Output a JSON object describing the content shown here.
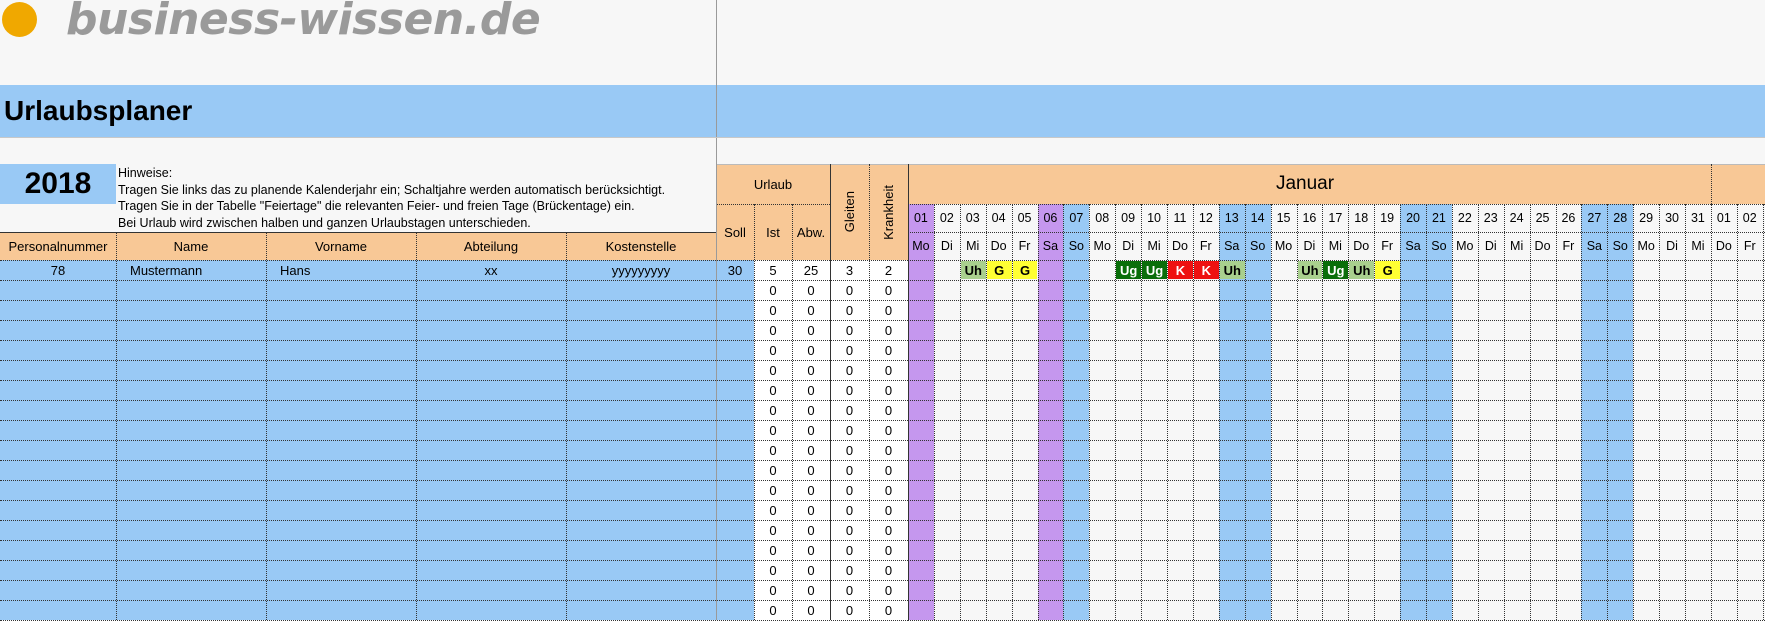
{
  "brand": {
    "name": "business-wissen.de"
  },
  "title": "Urlaubsplaner",
  "year": "2018",
  "notes": {
    "heading": "Hinweise:",
    "lines": [
      "Tragen Sie links das zu planende Kalenderjahr ein; Schaltjahre werden automatisch berücksichtigt.",
      "Tragen Sie in der Tabelle \"Feiertage\" die relevanten Feier- und freien Tage (Brückentage) ein.",
      "Bei Urlaub wird zwischen halben und ganzen Urlaubstagen unterschieden."
    ]
  },
  "columns": [
    "Personalnummer",
    "Name",
    "Vorname",
    "Abteilung",
    "Kostenstelle"
  ],
  "urlaub_header": "Urlaub",
  "urlaub_cols": [
    "Soll",
    "Ist",
    "Abw."
  ],
  "gleiten_header": "Gleiten",
  "krankheit_header": "Krankheit",
  "month": "Januar",
  "days": [
    {
      "n": "01",
      "d": "Mo",
      "t": "h"
    },
    {
      "n": "02",
      "d": "Di",
      "t": "w"
    },
    {
      "n": "03",
      "d": "Mi",
      "t": "w"
    },
    {
      "n": "04",
      "d": "Do",
      "t": "w"
    },
    {
      "n": "05",
      "d": "Fr",
      "t": "w"
    },
    {
      "n": "06",
      "d": "Sa",
      "t": "h"
    },
    {
      "n": "07",
      "d": "So",
      "t": "e"
    },
    {
      "n": "08",
      "d": "Mo",
      "t": "w"
    },
    {
      "n": "09",
      "d": "Di",
      "t": "w"
    },
    {
      "n": "10",
      "d": "Mi",
      "t": "w"
    },
    {
      "n": "11",
      "d": "Do",
      "t": "w"
    },
    {
      "n": "12",
      "d": "Fr",
      "t": "w"
    },
    {
      "n": "13",
      "d": "Sa",
      "t": "e"
    },
    {
      "n": "14",
      "d": "So",
      "t": "e"
    },
    {
      "n": "15",
      "d": "Mo",
      "t": "w"
    },
    {
      "n": "16",
      "d": "Di",
      "t": "w"
    },
    {
      "n": "17",
      "d": "Mi",
      "t": "w"
    },
    {
      "n": "18",
      "d": "Do",
      "t": "w"
    },
    {
      "n": "19",
      "d": "Fr",
      "t": "w"
    },
    {
      "n": "20",
      "d": "Sa",
      "t": "e"
    },
    {
      "n": "21",
      "d": "So",
      "t": "e"
    },
    {
      "n": "22",
      "d": "Mo",
      "t": "w"
    },
    {
      "n": "23",
      "d": "Di",
      "t": "w"
    },
    {
      "n": "24",
      "d": "Mi",
      "t": "w"
    },
    {
      "n": "25",
      "d": "Do",
      "t": "w"
    },
    {
      "n": "26",
      "d": "Fr",
      "t": "w"
    },
    {
      "n": "27",
      "d": "Sa",
      "t": "e"
    },
    {
      "n": "28",
      "d": "So",
      "t": "e"
    },
    {
      "n": "29",
      "d": "Mo",
      "t": "w"
    },
    {
      "n": "30",
      "d": "Di",
      "t": "w"
    },
    {
      "n": "31",
      "d": "Mi",
      "t": "w"
    },
    {
      "n": "01",
      "d": "Do",
      "t": "w"
    },
    {
      "n": "02",
      "d": "Fr",
      "t": "w"
    }
  ],
  "employee": {
    "personalnummer": "78",
    "name": "Mustermann",
    "vorname": "Hans",
    "abteilung": "xx",
    "kostenstelle": "yyyyyyyyy",
    "soll": "30",
    "ist": "5",
    "abw": "25",
    "gleiten": "3",
    "krankheit": "2"
  },
  "entries": [
    {
      "day": 3,
      "code": "Uh"
    },
    {
      "day": 4,
      "code": "G"
    },
    {
      "day": 5,
      "code": "G"
    },
    {
      "day": 9,
      "code": "Ug"
    },
    {
      "day": 10,
      "code": "Ug"
    },
    {
      "day": 11,
      "code": "K"
    },
    {
      "day": 12,
      "code": "K"
    },
    {
      "day": 13,
      "code": "Uh"
    },
    {
      "day": 16,
      "code": "Uh"
    },
    {
      "day": 17,
      "code": "Ug"
    },
    {
      "day": 18,
      "code": "Uh"
    },
    {
      "day": 19,
      "code": "G"
    }
  ],
  "empty_rows": {
    "count": 17,
    "ist": "0",
    "abw": "0",
    "gleiten": "0",
    "krankheit": "0"
  },
  "colors": {
    "brand_dot": "#f0a800",
    "brand_text": "#999999",
    "title_band": "#99c9f5",
    "header_peach": "#f8c896",
    "row_blue": "#99c9f5",
    "holiday_purple": "#c597ee",
    "weekend_blue": "#99c9f5",
    "uh": "#a9d08e",
    "ug": "#0a6e0a",
    "g": "#ffff33",
    "k": "#ee1111"
  }
}
